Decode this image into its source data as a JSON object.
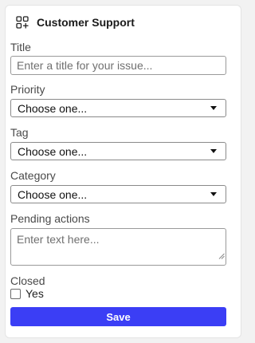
{
  "header": {
    "title": "Customer Support",
    "icon": "widgets-add-icon"
  },
  "form": {
    "title": {
      "label": "Title",
      "placeholder": "Enter a title for your issue..."
    },
    "priority": {
      "label": "Priority",
      "selected": "Choose one..."
    },
    "tag": {
      "label": "Tag",
      "selected": "Choose one..."
    },
    "category": {
      "label": "Category",
      "selected": "Choose one..."
    },
    "pending_actions": {
      "label": "Pending actions",
      "placeholder": "Enter text here..."
    },
    "closed": {
      "label": "Closed",
      "option_label": "Yes",
      "checked": false
    },
    "save_label": "Save"
  },
  "colors": {
    "accent": "#3b3ef5",
    "background": "#f2f2f2",
    "card": "#ffffff"
  }
}
